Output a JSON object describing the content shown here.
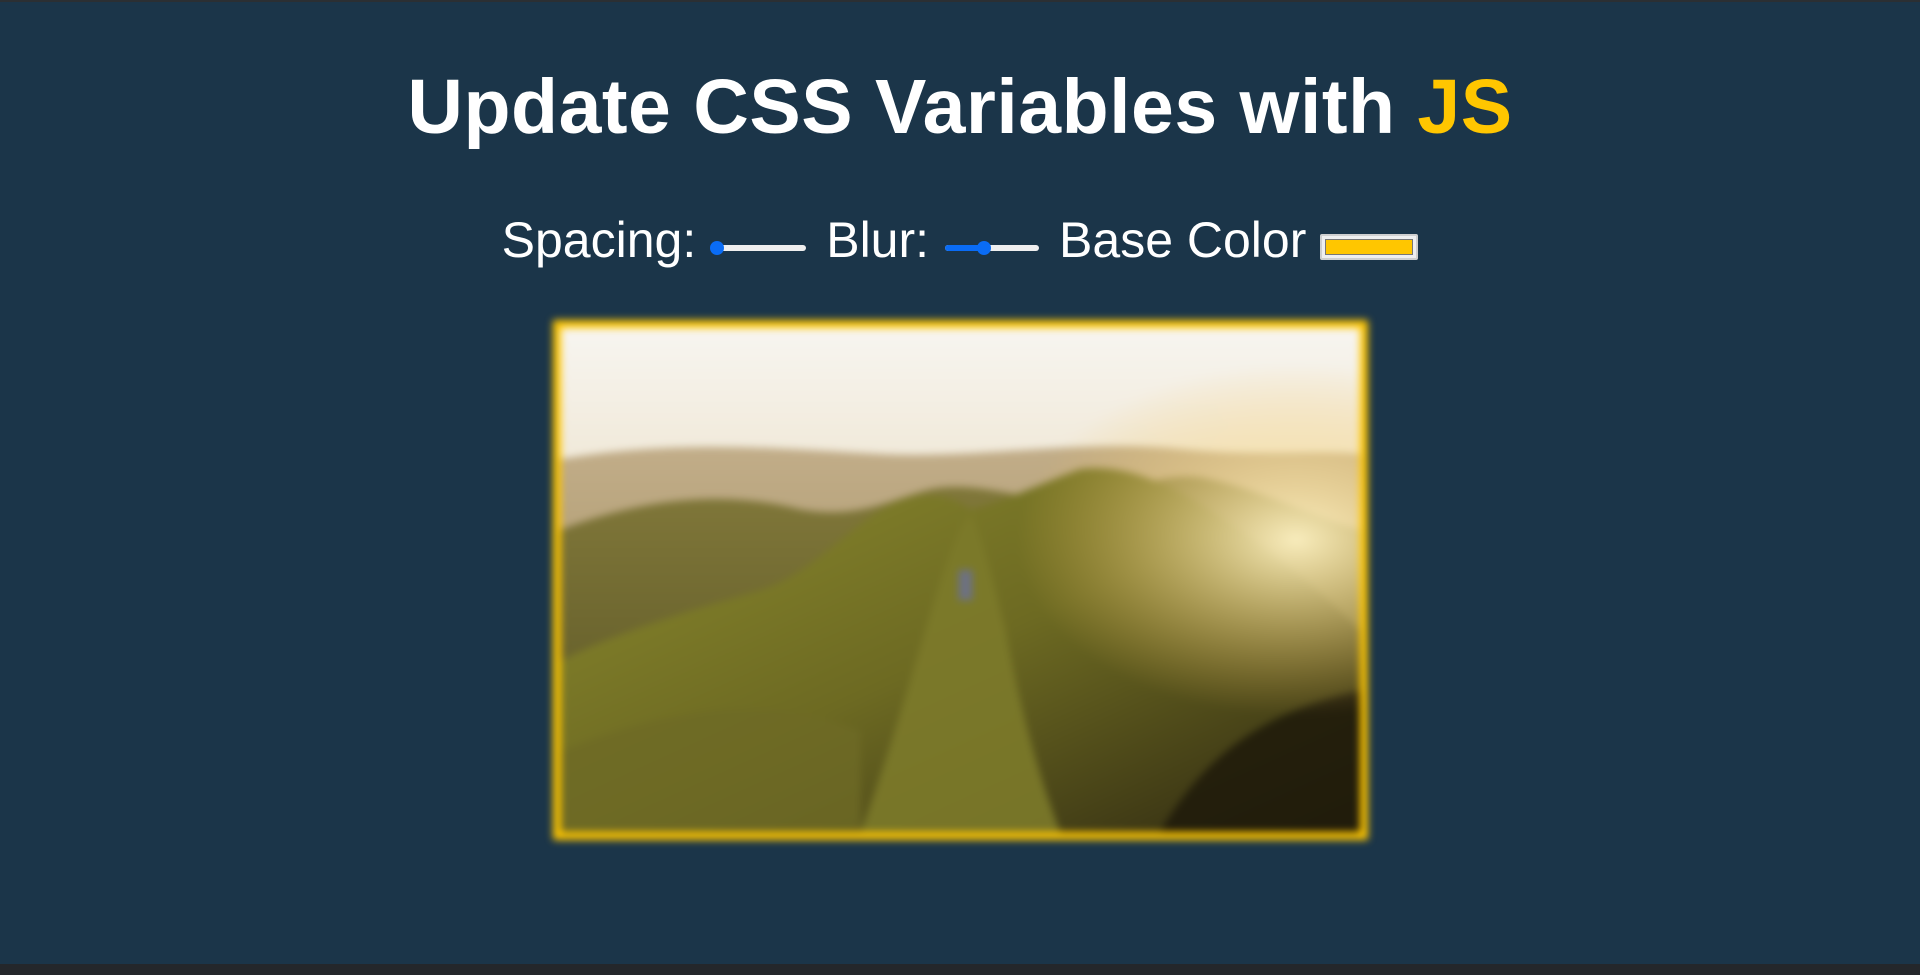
{
  "header": {
    "title_main": "Update CSS Variables with ",
    "title_highlight": "JS"
  },
  "controls": {
    "spacing": {
      "label": "Spacing:",
      "value_fraction": 0.0
    },
    "blur": {
      "label": "Blur:",
      "value_fraction": 0.4
    },
    "base_color": {
      "label": "Base Color",
      "value": "#ffc600"
    }
  },
  "colors": {
    "background": "#1b3549",
    "accent": "#ffc600",
    "slider": "#0a6cf5"
  },
  "image": {
    "icon": "mountain-landscape-photo"
  }
}
